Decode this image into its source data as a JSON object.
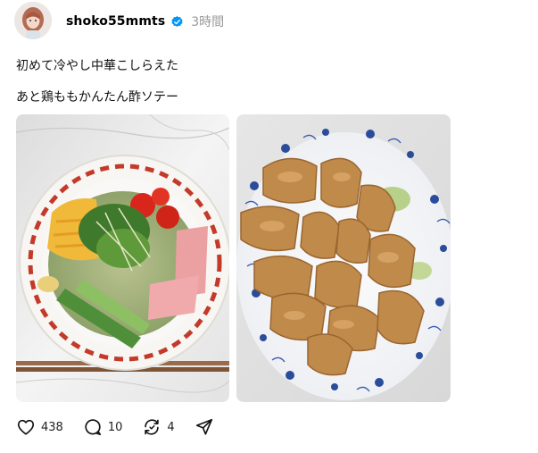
{
  "post": {
    "username": "shoko55mmts",
    "timestamp": "3時間",
    "verified": true,
    "caption_lines": [
      "初めて冷やし中華こしらえた",
      "あと鶏ももかんたん酢ソテー"
    ],
    "images": [
      {
        "alt": "冷やし中華"
      },
      {
        "alt": "鶏ももかんたん酢ソテー"
      }
    ],
    "actions": {
      "like_icon": "heart-icon",
      "like_count": "438",
      "comment_icon": "comment-icon",
      "comment_count": "10",
      "repost_icon": "repost-icon",
      "repost_count": "4",
      "share_icon": "share-icon"
    }
  },
  "colors": {
    "verified_blue": "#0095f6",
    "timestamp_gray": "#999999",
    "text": "#101010"
  }
}
